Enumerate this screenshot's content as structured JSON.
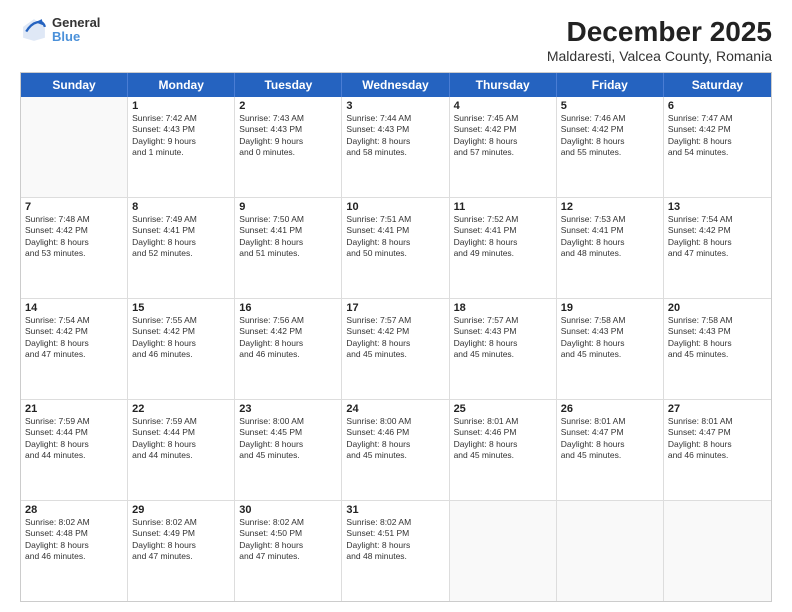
{
  "logo": {
    "line1": "General",
    "line2": "Blue"
  },
  "title": "December 2025",
  "subtitle": "Maldaresti, Valcea County, Romania",
  "header_days": [
    "Sunday",
    "Monday",
    "Tuesday",
    "Wednesday",
    "Thursday",
    "Friday",
    "Saturday"
  ],
  "rows": [
    [
      {
        "day": "",
        "info": ""
      },
      {
        "day": "1",
        "info": "Sunrise: 7:42 AM\nSunset: 4:43 PM\nDaylight: 9 hours\nand 1 minute."
      },
      {
        "day": "2",
        "info": "Sunrise: 7:43 AM\nSunset: 4:43 PM\nDaylight: 9 hours\nand 0 minutes."
      },
      {
        "day": "3",
        "info": "Sunrise: 7:44 AM\nSunset: 4:43 PM\nDaylight: 8 hours\nand 58 minutes."
      },
      {
        "day": "4",
        "info": "Sunrise: 7:45 AM\nSunset: 4:42 PM\nDaylight: 8 hours\nand 57 minutes."
      },
      {
        "day": "5",
        "info": "Sunrise: 7:46 AM\nSunset: 4:42 PM\nDaylight: 8 hours\nand 55 minutes."
      },
      {
        "day": "6",
        "info": "Sunrise: 7:47 AM\nSunset: 4:42 PM\nDaylight: 8 hours\nand 54 minutes."
      }
    ],
    [
      {
        "day": "7",
        "info": "Sunrise: 7:48 AM\nSunset: 4:42 PM\nDaylight: 8 hours\nand 53 minutes."
      },
      {
        "day": "8",
        "info": "Sunrise: 7:49 AM\nSunset: 4:41 PM\nDaylight: 8 hours\nand 52 minutes."
      },
      {
        "day": "9",
        "info": "Sunrise: 7:50 AM\nSunset: 4:41 PM\nDaylight: 8 hours\nand 51 minutes."
      },
      {
        "day": "10",
        "info": "Sunrise: 7:51 AM\nSunset: 4:41 PM\nDaylight: 8 hours\nand 50 minutes."
      },
      {
        "day": "11",
        "info": "Sunrise: 7:52 AM\nSunset: 4:41 PM\nDaylight: 8 hours\nand 49 minutes."
      },
      {
        "day": "12",
        "info": "Sunrise: 7:53 AM\nSunset: 4:41 PM\nDaylight: 8 hours\nand 48 minutes."
      },
      {
        "day": "13",
        "info": "Sunrise: 7:54 AM\nSunset: 4:42 PM\nDaylight: 8 hours\nand 47 minutes."
      }
    ],
    [
      {
        "day": "14",
        "info": "Sunrise: 7:54 AM\nSunset: 4:42 PM\nDaylight: 8 hours\nand 47 minutes."
      },
      {
        "day": "15",
        "info": "Sunrise: 7:55 AM\nSunset: 4:42 PM\nDaylight: 8 hours\nand 46 minutes."
      },
      {
        "day": "16",
        "info": "Sunrise: 7:56 AM\nSunset: 4:42 PM\nDaylight: 8 hours\nand 46 minutes."
      },
      {
        "day": "17",
        "info": "Sunrise: 7:57 AM\nSunset: 4:42 PM\nDaylight: 8 hours\nand 45 minutes."
      },
      {
        "day": "18",
        "info": "Sunrise: 7:57 AM\nSunset: 4:43 PM\nDaylight: 8 hours\nand 45 minutes."
      },
      {
        "day": "19",
        "info": "Sunrise: 7:58 AM\nSunset: 4:43 PM\nDaylight: 8 hours\nand 45 minutes."
      },
      {
        "day": "20",
        "info": "Sunrise: 7:58 AM\nSunset: 4:43 PM\nDaylight: 8 hours\nand 45 minutes."
      }
    ],
    [
      {
        "day": "21",
        "info": "Sunrise: 7:59 AM\nSunset: 4:44 PM\nDaylight: 8 hours\nand 44 minutes."
      },
      {
        "day": "22",
        "info": "Sunrise: 7:59 AM\nSunset: 4:44 PM\nDaylight: 8 hours\nand 44 minutes."
      },
      {
        "day": "23",
        "info": "Sunrise: 8:00 AM\nSunset: 4:45 PM\nDaylight: 8 hours\nand 45 minutes."
      },
      {
        "day": "24",
        "info": "Sunrise: 8:00 AM\nSunset: 4:46 PM\nDaylight: 8 hours\nand 45 minutes."
      },
      {
        "day": "25",
        "info": "Sunrise: 8:01 AM\nSunset: 4:46 PM\nDaylight: 8 hours\nand 45 minutes."
      },
      {
        "day": "26",
        "info": "Sunrise: 8:01 AM\nSunset: 4:47 PM\nDaylight: 8 hours\nand 45 minutes."
      },
      {
        "day": "27",
        "info": "Sunrise: 8:01 AM\nSunset: 4:47 PM\nDaylight: 8 hours\nand 46 minutes."
      }
    ],
    [
      {
        "day": "28",
        "info": "Sunrise: 8:02 AM\nSunset: 4:48 PM\nDaylight: 8 hours\nand 46 minutes."
      },
      {
        "day": "29",
        "info": "Sunrise: 8:02 AM\nSunset: 4:49 PM\nDaylight: 8 hours\nand 47 minutes."
      },
      {
        "day": "30",
        "info": "Sunrise: 8:02 AM\nSunset: 4:50 PM\nDaylight: 8 hours\nand 47 minutes."
      },
      {
        "day": "31",
        "info": "Sunrise: 8:02 AM\nSunset: 4:51 PM\nDaylight: 8 hours\nand 48 minutes."
      },
      {
        "day": "",
        "info": ""
      },
      {
        "day": "",
        "info": ""
      },
      {
        "day": "",
        "info": ""
      }
    ]
  ]
}
